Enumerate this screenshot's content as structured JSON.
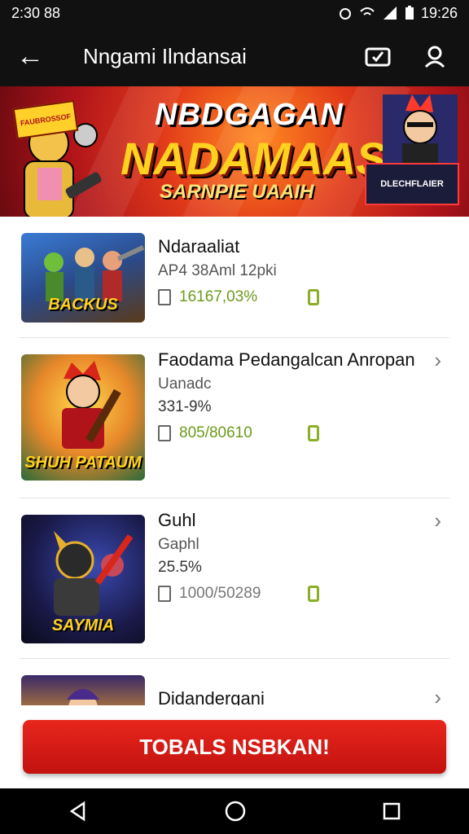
{
  "status_bar": {
    "time": "2:30 88",
    "clock": "19:26"
  },
  "app_bar": {
    "back_glyph": "←",
    "title": "Nngami Ilndansai"
  },
  "banner": {
    "headline_top": "NBDGAGAN",
    "headline_main": "NADAMAAS!",
    "subheadline": "SARNPIE UAAIH",
    "badge_left": "FAUBROSSOF",
    "tag_right": "DLECHFLAIER"
  },
  "items": [
    {
      "name": "Ndaraaliat",
      "meta": "AP4 38Aml 12pki",
      "percent": "",
      "stat": "16167,03%",
      "stat_grey": false,
      "thumb_caption": "BACKUS",
      "chevron": ""
    },
    {
      "name": "Faodama Pedangalcan Anropan",
      "meta": "Uanadc",
      "percent": "331-9%",
      "stat": "805/80610",
      "stat_grey": false,
      "thumb_caption": "SHUH PATAUM",
      "chevron": "›"
    },
    {
      "name": "Guhl",
      "meta": "Gaphl",
      "percent": "25.5%",
      "stat": "1000/50289",
      "stat_grey": true,
      "thumb_caption": "SAYMIA",
      "chevron": "›"
    },
    {
      "name": "Didandergani",
      "meta": "",
      "percent": "",
      "stat": "",
      "stat_grey": false,
      "thumb_caption": "",
      "chevron": "›"
    }
  ],
  "cta": {
    "label": "TOBALS NSBKAN!"
  },
  "colors": {
    "accent": "#d81e18",
    "stat_green": "#6b9b1a",
    "bar_bg": "#111111"
  }
}
